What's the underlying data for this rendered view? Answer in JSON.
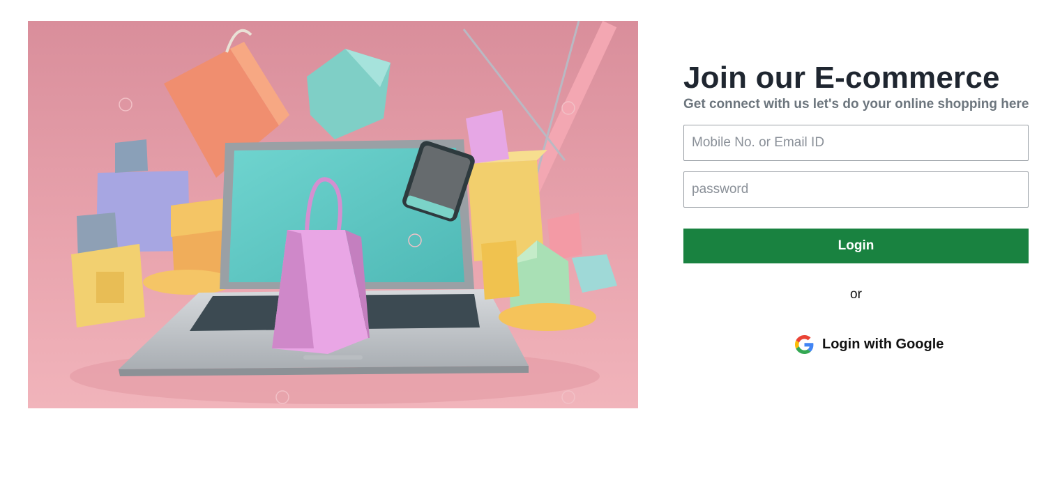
{
  "hero": {
    "icon": "ecommerce-illustration",
    "colors": {
      "background": "#e8a2ad",
      "screen": "#5fc8c4",
      "laptop": "#c4c9ce",
      "bag": "#e5a3e2"
    }
  },
  "login": {
    "title": "Join our E-commerce",
    "subtitle": "Get connect with us let's do your online shopping here",
    "email_placeholder": "Mobile No. or Email ID",
    "password_placeholder": "password",
    "login_label": "Login",
    "or_text": "or",
    "google_label": "Login with Google",
    "google_icon": "google-icon"
  },
  "colors": {
    "primary": "#198240",
    "title": "#1f2630",
    "subtitle": "#6c757d"
  }
}
